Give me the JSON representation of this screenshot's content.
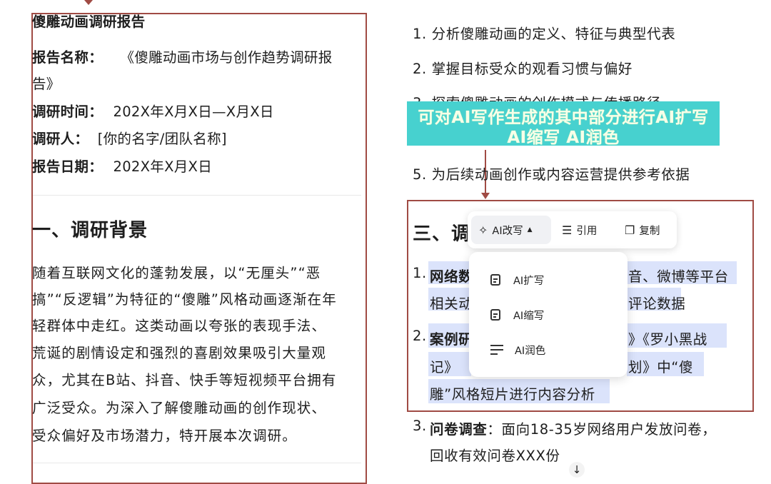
{
  "left": {
    "doc_title": "傻雕动画调研报告",
    "report_name_label": "报告名称：",
    "report_name_line1": "《傻雕动画市场与创作趋势调研报",
    "report_name_line2": "告》",
    "survey_time_label": "调研时间：",
    "survey_time_value": "202X年X月X日—X月X日",
    "researcher_label": "调研人：",
    "researcher_value": "[你的名字/团队名称]",
    "report_date_label": "报告日期：",
    "report_date_value": "202X年X月X日",
    "section1_heading": "一、调研背景",
    "section1_lines": [
      "随着互联网文化的蓬勃发展，以“无厘头”“恶",
      "搞”“反逻辑”为特征的“傻雕”风格动画逐渐在年",
      "轻群体中走红。这类动画以夸张的表现手法、",
      "荒诞的剧情设定和强烈的喜剧效果吸引大量观",
      "众，尤其在B站、抖音、快手等短视频平台拥有",
      "广泛受众。为深入了解傻雕动画的创作现状、",
      "受众偏好及市场潜力，特开展本次调研。"
    ]
  },
  "right": {
    "goals": [
      "1. 分析傻雕动画的定义、特征与典型代表",
      "2. 掌握目标受众的观看习惯与偏好",
      "3. 探索傻雕动画的创作模式与传播路径",
      "5. 为后续动画创作或内容运营提供参考依据"
    ],
    "banner_line1": "可对AI写作生成的其中部分进行AI扩写",
    "banner_line2": "AI缩写 AI润色",
    "section3_heading_partial": "三、调",
    "method1_bold": "网络数",
    "method1_rest": "音、微博等平台",
    "method1_line2_start": "相关动",
    "method1_line2_end": "评论数据",
    "method2_bold": "案例研",
    "method2_rest_right": "》《罗小黑战",
    "method2_line2_start": "记》",
    "method2_line2_end": "划》中“傻",
    "method2_line3": "雕”风格短片进行内容分析",
    "method3_bold": "问卷调查",
    "method3_rest": "：面向18-35岁网络用户发放问卷，",
    "method3_line2": "回收有效问卷XXX份",
    "n1": "1.",
    "n2": "2.",
    "n3": "3."
  },
  "toolbar": {
    "ai_rewrite": "AI改写",
    "quote": "引用",
    "copy": "复制"
  },
  "dropdown": {
    "expand": "AI扩写",
    "shrink": "AI缩写",
    "polish": "AI润色"
  },
  "colors": {
    "frame": "#a04b44",
    "banner": "#47d1cf",
    "highlight": "#dbe3fb"
  }
}
